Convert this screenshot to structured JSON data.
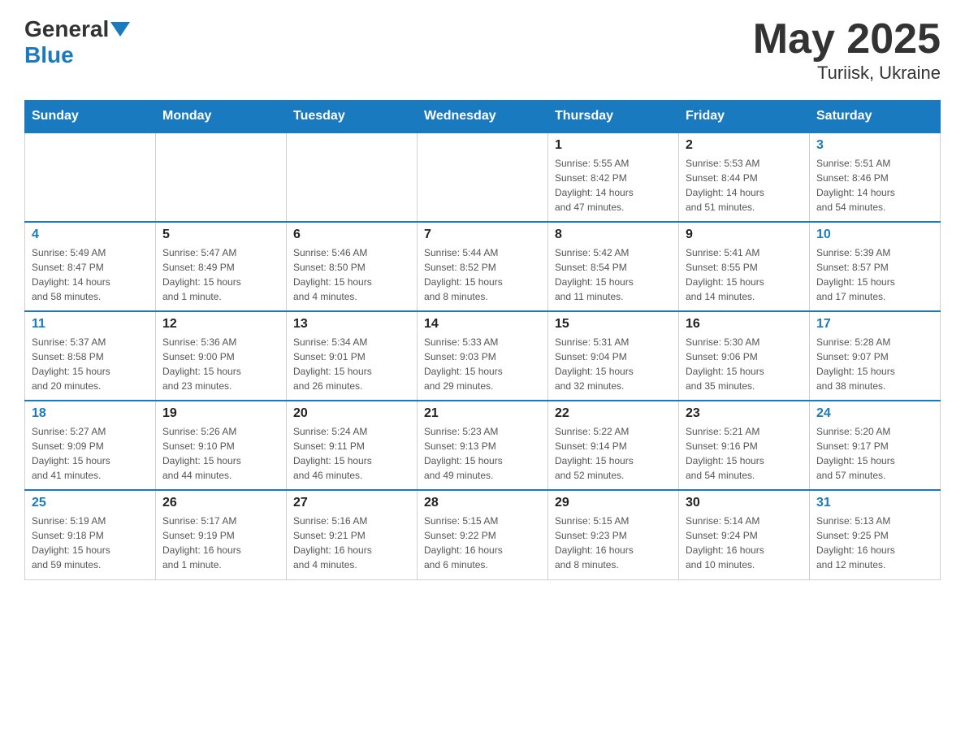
{
  "header": {
    "logo_general": "General",
    "logo_blue": "Blue",
    "month_year": "May 2025",
    "location": "Turiisk, Ukraine"
  },
  "weekdays": [
    "Sunday",
    "Monday",
    "Tuesday",
    "Wednesday",
    "Thursday",
    "Friday",
    "Saturday"
  ],
  "weeks": [
    [
      {
        "day": "",
        "info": ""
      },
      {
        "day": "",
        "info": ""
      },
      {
        "day": "",
        "info": ""
      },
      {
        "day": "",
        "info": ""
      },
      {
        "day": "1",
        "info": "Sunrise: 5:55 AM\nSunset: 8:42 PM\nDaylight: 14 hours\nand 47 minutes."
      },
      {
        "day": "2",
        "info": "Sunrise: 5:53 AM\nSunset: 8:44 PM\nDaylight: 14 hours\nand 51 minutes."
      },
      {
        "day": "3",
        "info": "Sunrise: 5:51 AM\nSunset: 8:46 PM\nDaylight: 14 hours\nand 54 minutes."
      }
    ],
    [
      {
        "day": "4",
        "info": "Sunrise: 5:49 AM\nSunset: 8:47 PM\nDaylight: 14 hours\nand 58 minutes."
      },
      {
        "day": "5",
        "info": "Sunrise: 5:47 AM\nSunset: 8:49 PM\nDaylight: 15 hours\nand 1 minute."
      },
      {
        "day": "6",
        "info": "Sunrise: 5:46 AM\nSunset: 8:50 PM\nDaylight: 15 hours\nand 4 minutes."
      },
      {
        "day": "7",
        "info": "Sunrise: 5:44 AM\nSunset: 8:52 PM\nDaylight: 15 hours\nand 8 minutes."
      },
      {
        "day": "8",
        "info": "Sunrise: 5:42 AM\nSunset: 8:54 PM\nDaylight: 15 hours\nand 11 minutes."
      },
      {
        "day": "9",
        "info": "Sunrise: 5:41 AM\nSunset: 8:55 PM\nDaylight: 15 hours\nand 14 minutes."
      },
      {
        "day": "10",
        "info": "Sunrise: 5:39 AM\nSunset: 8:57 PM\nDaylight: 15 hours\nand 17 minutes."
      }
    ],
    [
      {
        "day": "11",
        "info": "Sunrise: 5:37 AM\nSunset: 8:58 PM\nDaylight: 15 hours\nand 20 minutes."
      },
      {
        "day": "12",
        "info": "Sunrise: 5:36 AM\nSunset: 9:00 PM\nDaylight: 15 hours\nand 23 minutes."
      },
      {
        "day": "13",
        "info": "Sunrise: 5:34 AM\nSunset: 9:01 PM\nDaylight: 15 hours\nand 26 minutes."
      },
      {
        "day": "14",
        "info": "Sunrise: 5:33 AM\nSunset: 9:03 PM\nDaylight: 15 hours\nand 29 minutes."
      },
      {
        "day": "15",
        "info": "Sunrise: 5:31 AM\nSunset: 9:04 PM\nDaylight: 15 hours\nand 32 minutes."
      },
      {
        "day": "16",
        "info": "Sunrise: 5:30 AM\nSunset: 9:06 PM\nDaylight: 15 hours\nand 35 minutes."
      },
      {
        "day": "17",
        "info": "Sunrise: 5:28 AM\nSunset: 9:07 PM\nDaylight: 15 hours\nand 38 minutes."
      }
    ],
    [
      {
        "day": "18",
        "info": "Sunrise: 5:27 AM\nSunset: 9:09 PM\nDaylight: 15 hours\nand 41 minutes."
      },
      {
        "day": "19",
        "info": "Sunrise: 5:26 AM\nSunset: 9:10 PM\nDaylight: 15 hours\nand 44 minutes."
      },
      {
        "day": "20",
        "info": "Sunrise: 5:24 AM\nSunset: 9:11 PM\nDaylight: 15 hours\nand 46 minutes."
      },
      {
        "day": "21",
        "info": "Sunrise: 5:23 AM\nSunset: 9:13 PM\nDaylight: 15 hours\nand 49 minutes."
      },
      {
        "day": "22",
        "info": "Sunrise: 5:22 AM\nSunset: 9:14 PM\nDaylight: 15 hours\nand 52 minutes."
      },
      {
        "day": "23",
        "info": "Sunrise: 5:21 AM\nSunset: 9:16 PM\nDaylight: 15 hours\nand 54 minutes."
      },
      {
        "day": "24",
        "info": "Sunrise: 5:20 AM\nSunset: 9:17 PM\nDaylight: 15 hours\nand 57 minutes."
      }
    ],
    [
      {
        "day": "25",
        "info": "Sunrise: 5:19 AM\nSunset: 9:18 PM\nDaylight: 15 hours\nand 59 minutes."
      },
      {
        "day": "26",
        "info": "Sunrise: 5:17 AM\nSunset: 9:19 PM\nDaylight: 16 hours\nand 1 minute."
      },
      {
        "day": "27",
        "info": "Sunrise: 5:16 AM\nSunset: 9:21 PM\nDaylight: 16 hours\nand 4 minutes."
      },
      {
        "day": "28",
        "info": "Sunrise: 5:15 AM\nSunset: 9:22 PM\nDaylight: 16 hours\nand 6 minutes."
      },
      {
        "day": "29",
        "info": "Sunrise: 5:15 AM\nSunset: 9:23 PM\nDaylight: 16 hours\nand 8 minutes."
      },
      {
        "day": "30",
        "info": "Sunrise: 5:14 AM\nSunset: 9:24 PM\nDaylight: 16 hours\nand 10 minutes."
      },
      {
        "day": "31",
        "info": "Sunrise: 5:13 AM\nSunset: 9:25 PM\nDaylight: 16 hours\nand 12 minutes."
      }
    ]
  ]
}
